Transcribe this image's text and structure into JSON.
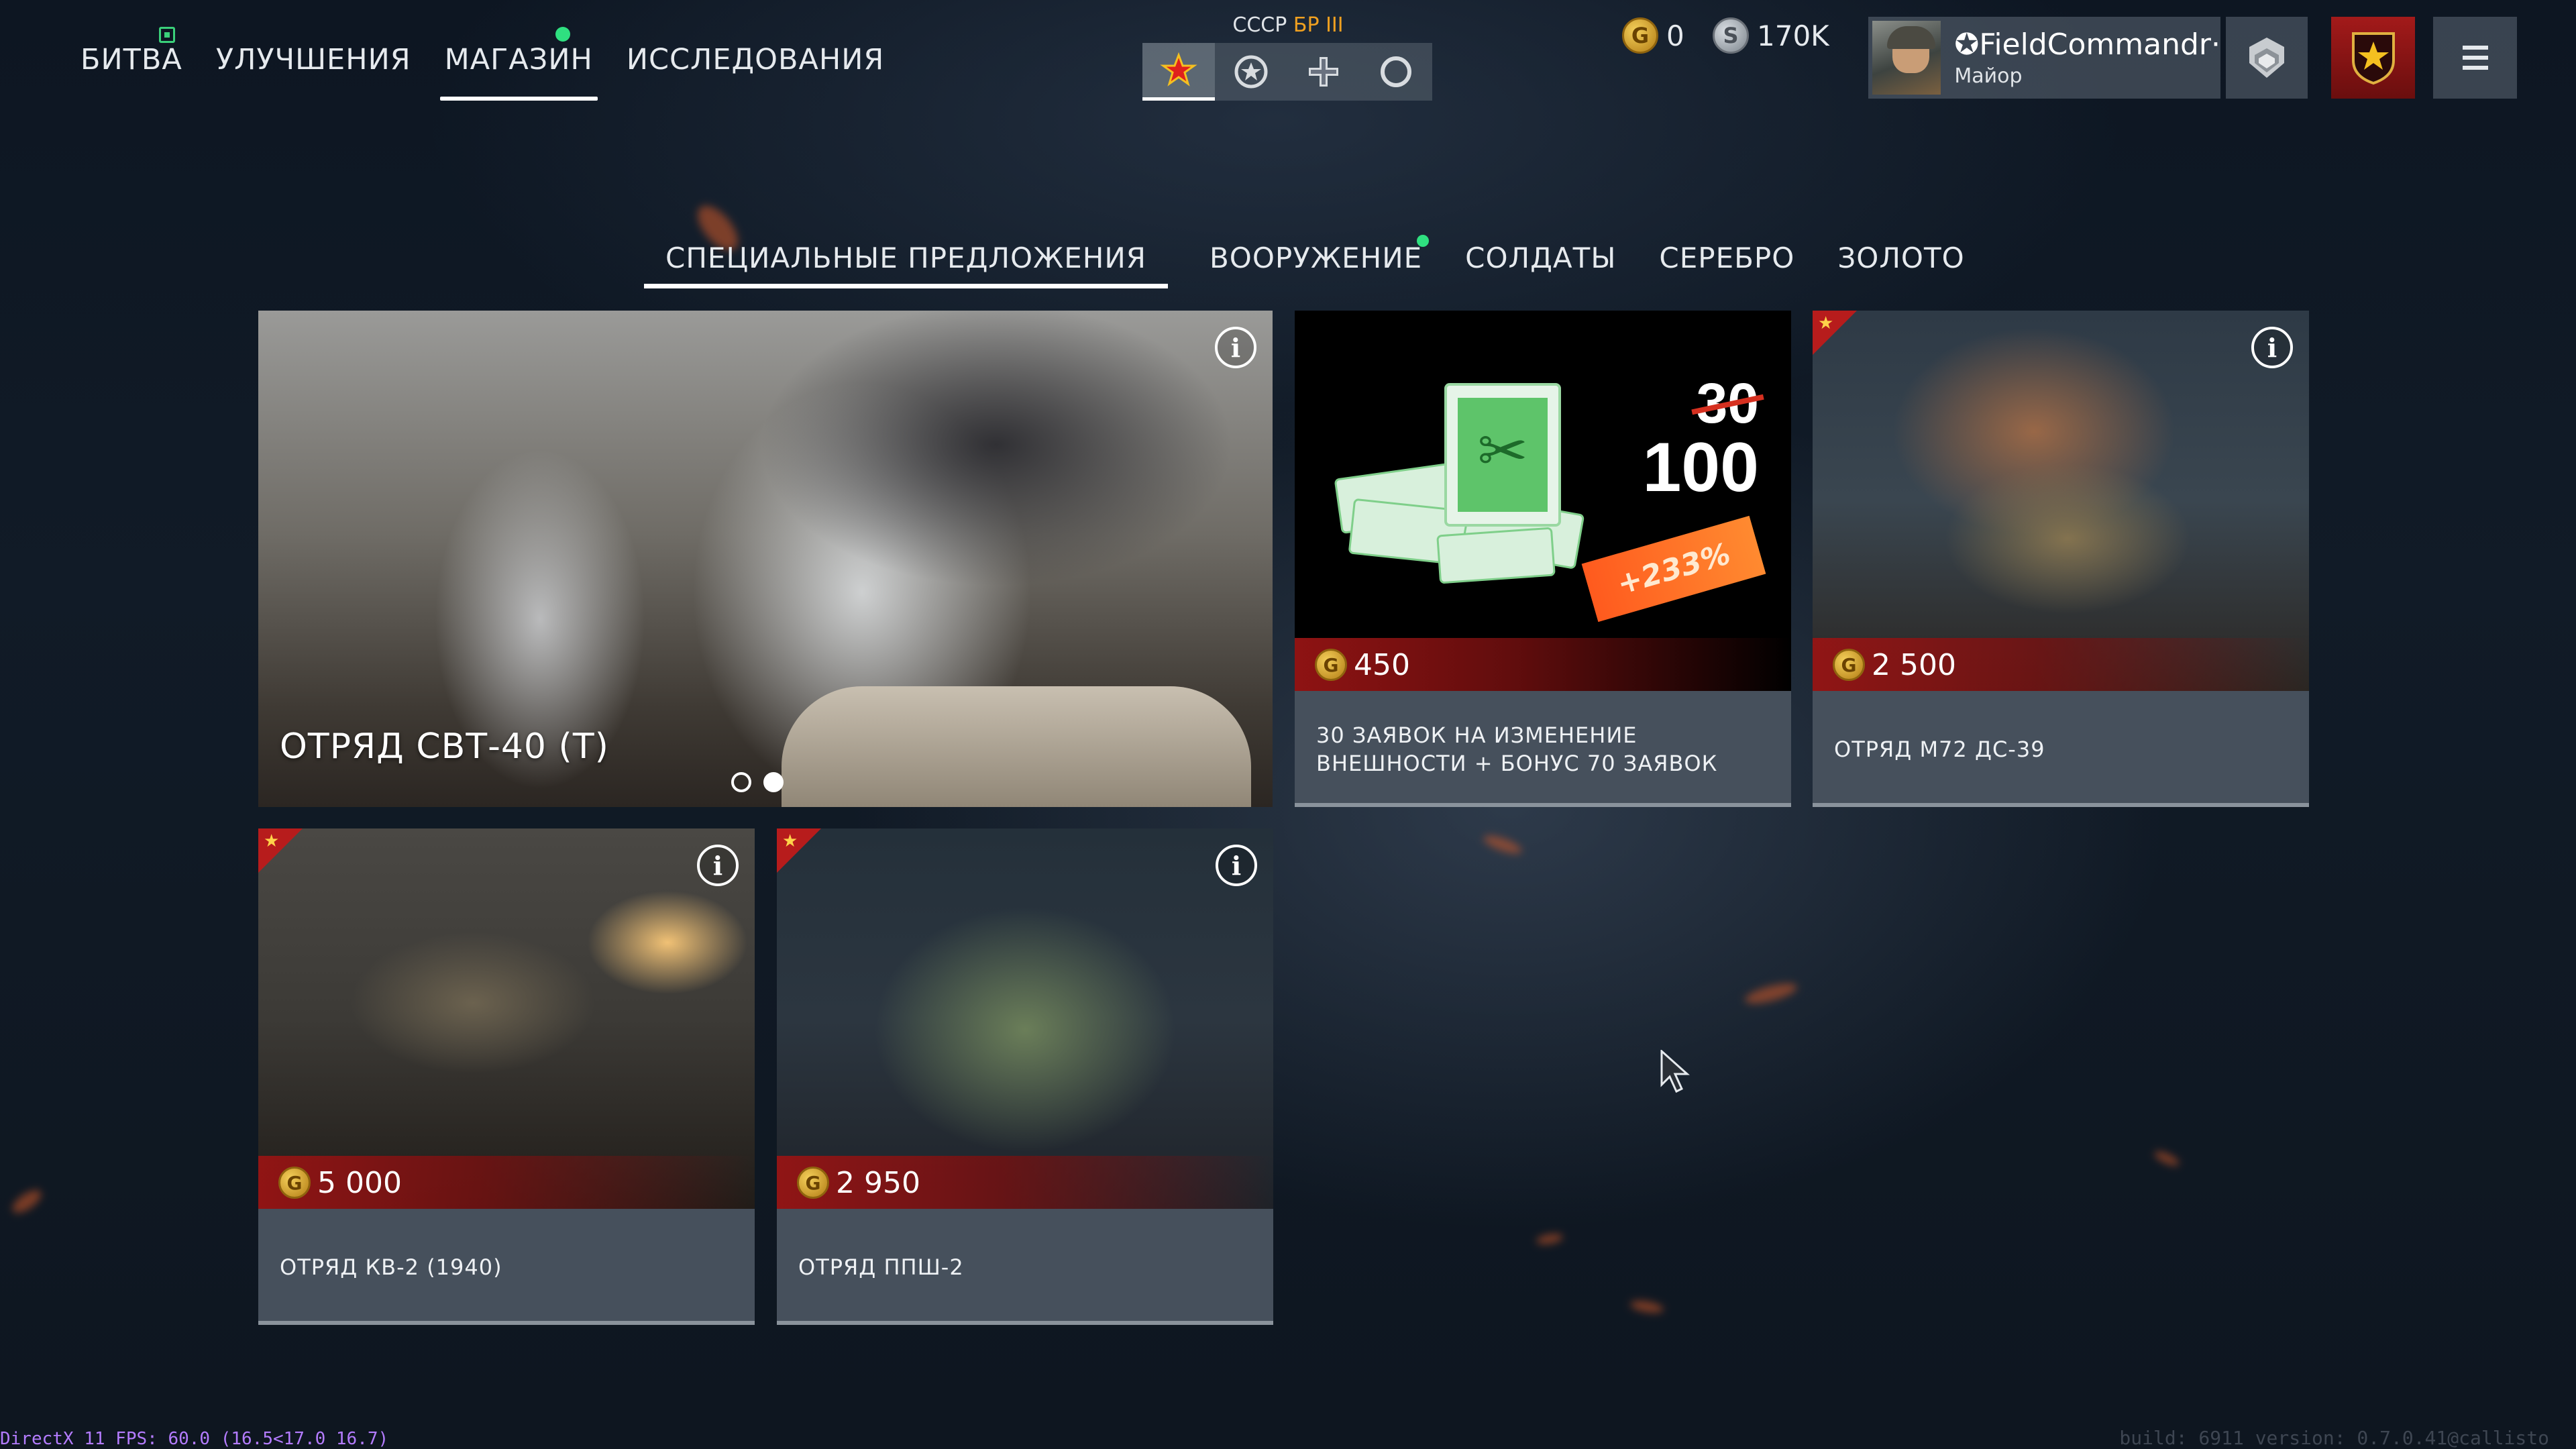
{
  "nav": {
    "items": [
      {
        "label": "БИТВА"
      },
      {
        "label": "УЛУЧШЕНИЯ"
      },
      {
        "label": "МАГАЗИН"
      },
      {
        "label": "ИССЛЕДОВАНИЯ"
      }
    ],
    "active": "МАГАЗИН"
  },
  "nation_selector": {
    "nation": "СССР",
    "br": "БР III",
    "tabs": [
      "star-icon",
      "medal-icon",
      "cross-icon",
      "circle-icon"
    ]
  },
  "currency": {
    "gold": "0",
    "silver": "170K"
  },
  "profile": {
    "name": "✪FieldCommandr·",
    "rank": "Майор"
  },
  "shop_tabs": [
    {
      "label": "СПЕЦИАЛЬНЫЕ ПРЕДЛОЖЕНИЯ"
    },
    {
      "label": "ВООРУЖЕНИЕ"
    },
    {
      "label": "СОЛДАТЫ"
    },
    {
      "label": "СЕРЕБРО"
    },
    {
      "label": "ЗОЛОТО"
    }
  ],
  "active_shop_tab": "СПЕЦИАЛЬНЫЕ ПРЕДЛОЖЕНИЯ",
  "cards": {
    "hero": {
      "title": "ОТРЯД СВТ-40 (Т)",
      "pages": 2,
      "current_page": 2
    },
    "vouchers": {
      "price": "450",
      "old_amount": "30",
      "new_amount": "100",
      "bonus": "+233%",
      "caption": "30 ЗАЯВОК НА ИЗМЕНЕНИЕ ВНЕШНОСТИ + БОНУС 70 ЗАЯВОК"
    },
    "m72": {
      "price": "2 500",
      "caption": "ОТРЯД М72 ДС-39"
    },
    "kv2": {
      "price": "5 000",
      "caption": "ОТРЯД КВ-2 (1940)"
    },
    "ppsh": {
      "price": "2 950",
      "caption": "ОТРЯД ППШ-2"
    }
  },
  "footer": {
    "fps": "DirectX 11 FPS: 60.0 (16.5<17.0 16.7)",
    "build": "build: 6911 version: 0.7.0.41@callisto"
  },
  "colors": {
    "accent_red": "#b71c1c",
    "gold": "#d9a520",
    "green_badge": "#2fe080",
    "caption_bg": "#46505c"
  }
}
